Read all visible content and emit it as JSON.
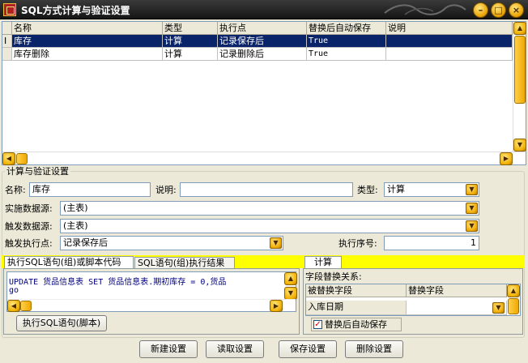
{
  "window": {
    "title": "SQL方式计算与验证设置"
  },
  "grid": {
    "row_marker": "I",
    "headers": [
      "名称",
      "类型",
      "执行点",
      "替换后自动保存",
      "说明"
    ],
    "rows": [
      [
        "库存",
        "计算",
        "记录保存后",
        "True",
        ""
      ],
      [
        "库存删除",
        "计算",
        "记录删除后",
        "True",
        ""
      ]
    ]
  },
  "settings": {
    "group_title": "计算与验证设置",
    "name_label": "名称:",
    "name_value": "库存",
    "desc_label": "说明:",
    "desc_value": "",
    "type_label": "类型:",
    "type_value": "计算",
    "source_label": "实施数据源:",
    "source_value": "(主表)",
    "trigger_source_label": "触发数据源:",
    "trigger_source_value": "(主表)",
    "trigger_point_label": "触发执行点:",
    "trigger_point_value": "记录保存后",
    "exec_order_label": "执行序号:",
    "exec_order_value": "1"
  },
  "sql_tabs": {
    "tab1": "执行SQL语句(组)或脚本代码",
    "tab2": "SQL语句(组)执行结果",
    "code_line1": "UPDATE 货品信息表 SET 货品信息表.期初库存 = 0,货品",
    "code_line2": "go",
    "run_button": "执行SQL语句(脚本)"
  },
  "calc_panel": {
    "tab": "计算",
    "relation_label": "字段替换关系:",
    "col1": "被替换字段",
    "col2": "替换字段",
    "row1_field": "入库日期",
    "row1_value": "",
    "autosave_label": "替换后自动保存",
    "autosave_checked": true
  },
  "footer": {
    "new": "新建设置",
    "read": "读取设置",
    "save": "保存设置",
    "delete": "删除设置"
  }
}
